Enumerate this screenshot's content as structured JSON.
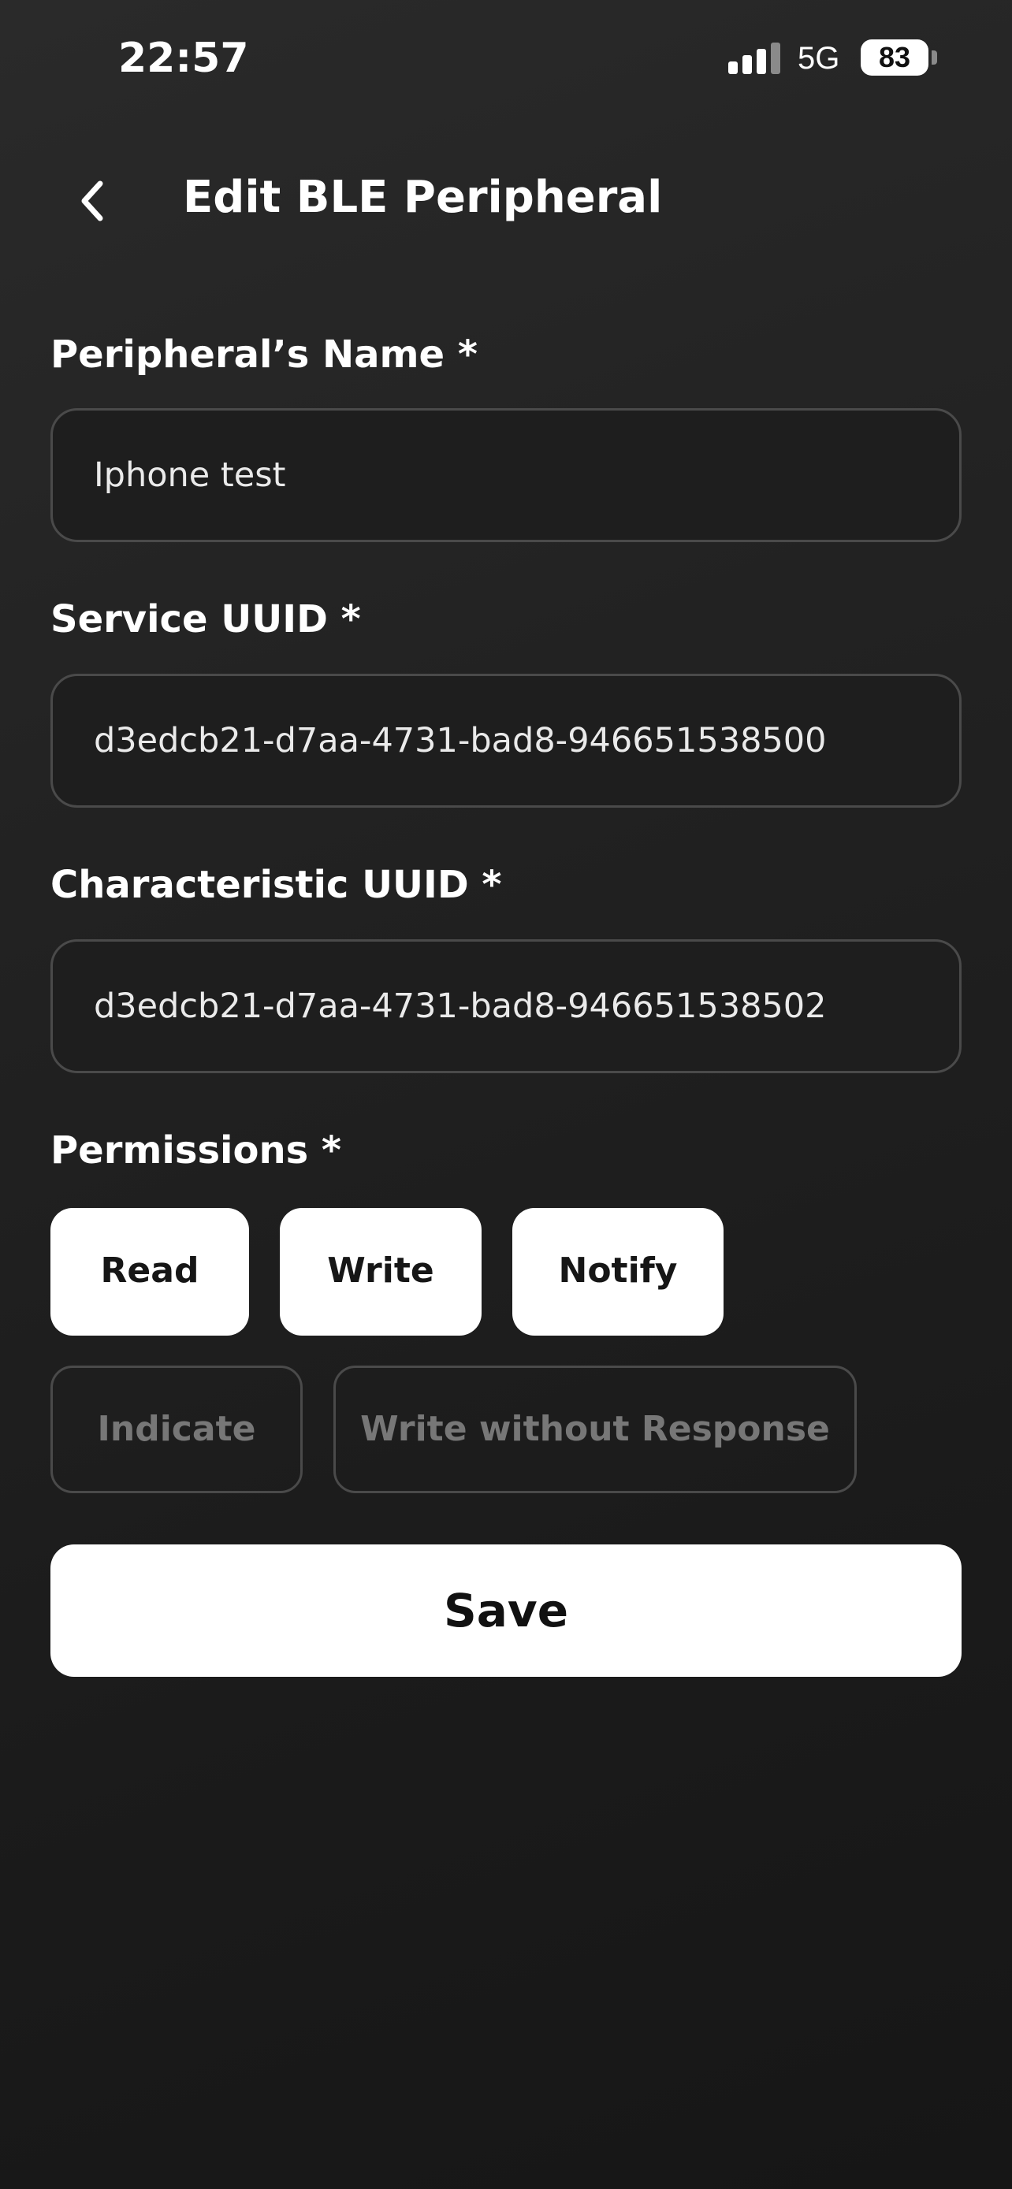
{
  "status_bar": {
    "time": "22:57",
    "network": "5G",
    "battery": "83"
  },
  "header": {
    "title": "Edit BLE Peripheral",
    "back_icon": "chevron-left-icon"
  },
  "form": {
    "name_label": "Peripheral’s Name *",
    "name_value": "Iphone test",
    "service_label": "Service UUID *",
    "service_value": "d3edcb21-d7aa-4731-bad8-946651538500",
    "characteristic_label": "Characteristic UUID *",
    "characteristic_value": "d3edcb21-d7aa-4731-bad8-946651538502",
    "permissions_label": "Permissions *",
    "permissions": [
      {
        "label": "Read",
        "selected": true
      },
      {
        "label": "Write",
        "selected": true
      },
      {
        "label": "Notify",
        "selected": true
      },
      {
        "label": "Indicate",
        "selected": false
      },
      {
        "label": "Write without Response",
        "selected": false
      }
    ]
  },
  "save_label": "Save",
  "colors": {
    "background": "#1e1e1e",
    "selected_chip": "#ffffff",
    "unselected_text": "#777777",
    "border": "#4a4a4a"
  }
}
